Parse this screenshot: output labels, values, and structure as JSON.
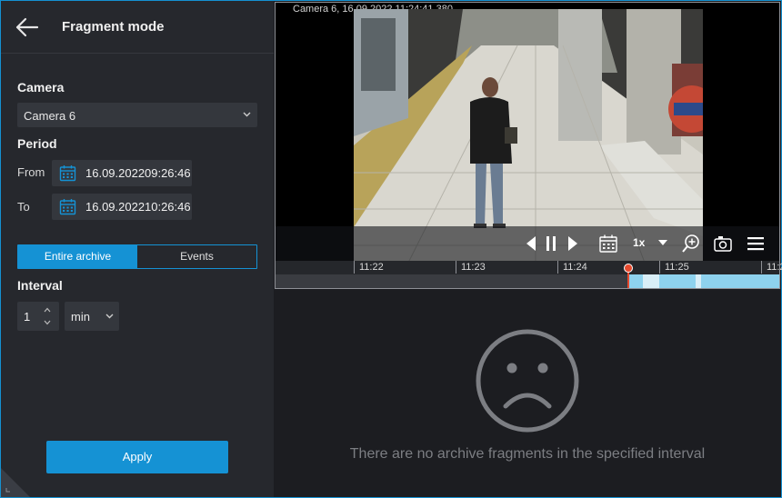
{
  "header": {
    "title": "Fragment mode",
    "back_icon": "arrow-left-icon"
  },
  "camera": {
    "label": "Camera",
    "selected": "Camera 6"
  },
  "period": {
    "label": "Period",
    "from": {
      "label": "From",
      "date": "16.09.2022",
      "time": "09:26:46"
    },
    "to": {
      "label": "To",
      "date": "16.09.2022",
      "time": "10:26:46"
    }
  },
  "mode_tabs": {
    "entire_archive": "Entire archive",
    "events": "Events",
    "active": "Entire archive"
  },
  "interval": {
    "label": "Interval",
    "value": "1",
    "unit": "min"
  },
  "apply_label": "Apply",
  "player": {
    "overlay_title": "Camera 6, 16.09.2022 11:24:41.380",
    "speed": "1x",
    "timeline_labels": [
      "11:22",
      "11:23",
      "11:24",
      "11:25",
      "11:2"
    ],
    "icons": [
      "prev-frame-icon",
      "pause-icon",
      "next-frame-icon",
      "calendar-icon",
      "chevron-down-icon",
      "zoom-in-icon",
      "snapshot-icon",
      "menu-icon"
    ]
  },
  "empty_state": {
    "message": "There are no archive fragments in the specified interval",
    "icon": "sad-face-icon"
  },
  "colors": {
    "accent": "#1592d4",
    "panel": "#26282d",
    "background": "#1c1d21",
    "field": "#34373d",
    "playhead": "#e64a2e",
    "archive_fill": "#8ed2ee"
  }
}
